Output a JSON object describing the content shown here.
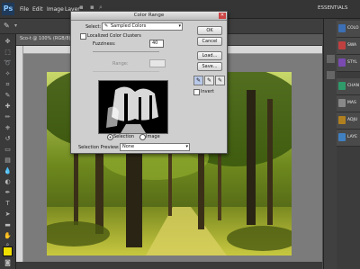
{
  "menubar": {
    "logo": "Ps",
    "items": [
      "File",
      "Edit",
      "Image",
      "Layer"
    ],
    "workspace": "ESSENTIALS"
  },
  "document": {
    "tab_label": "Sco-t @ 100% (RGB/8)"
  },
  "tool_colors": {
    "foreground": "#f0e000",
    "background": "#1a1a1a"
  },
  "panels": [
    {
      "label": "COLO",
      "color": "#3c6fb4"
    },
    {
      "label": "SWA",
      "color": "#c04040"
    },
    {
      "label": "STYL",
      "color": "#7a4ab0"
    },
    {
      "label": "CHAN",
      "color": "#2f9a6a"
    },
    {
      "label": "MAS",
      "color": "#888888"
    },
    {
      "label": "ADJU",
      "color": "#b08020"
    },
    {
      "label": "LAYE",
      "color": "#4080c0"
    }
  ],
  "dialog": {
    "title": "Color Range",
    "select_label": "Select:",
    "select_value": "Sampled Colors",
    "localized_label": "Localized Color Clusters",
    "fuzziness_label": "Fuzziness:",
    "fuzziness_value": "40",
    "range_label": "Range:",
    "radio_selection": "Selection",
    "radio_image": "Image",
    "preview_label": "Selection Preview:",
    "preview_value": "None",
    "invert_label": "Invert",
    "buttons": {
      "ok": "OK",
      "cancel": "Cancel",
      "load": "Load...",
      "save": "Save..."
    }
  }
}
